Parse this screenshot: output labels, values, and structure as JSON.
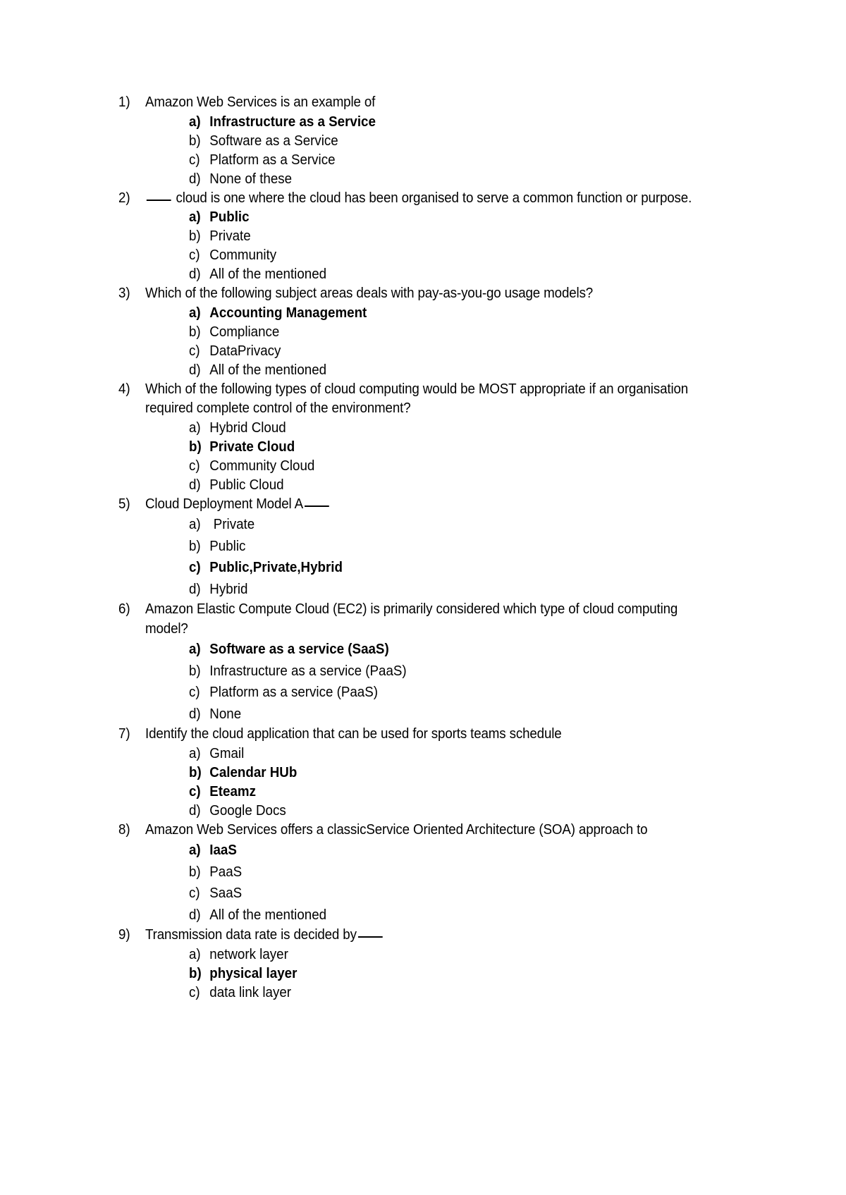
{
  "document": {
    "type": "multiple-choice-quiz",
    "questions": [
      {
        "number": "1)",
        "text": "Amazon Web Services is an example of",
        "has_blank": false,
        "options": [
          {
            "marker": "a)",
            "label": "Infrastructure as a Service",
            "correct": true
          },
          {
            "marker": "b)",
            "label": "Software as a Service",
            "correct": false
          },
          {
            "marker": "c)",
            "label": "Platform  as a Service",
            "correct": false
          },
          {
            "marker": "d)",
            "label": "None of these",
            "correct": false
          }
        ]
      },
      {
        "number": "2)",
        "text_before_blank": "",
        "text": " cloud is one where the cloud has been organised to serve a common function or purpose.",
        "has_blank": true,
        "options": [
          {
            "marker": "a)",
            "label": "Public",
            "correct": true
          },
          {
            "marker": "b)",
            "label": "Private",
            "correct": false
          },
          {
            "marker": "c)",
            "label": "Community",
            "correct": false
          },
          {
            "marker": "d)",
            "label": "All of the mentioned",
            "correct": false
          }
        ]
      },
      {
        "number": "3)",
        "text": "Which of the following subject areas deals with pay-as-you-go usage models?",
        "has_blank": false,
        "options": [
          {
            "marker": "a)",
            "label": "Accounting Management",
            "correct": true
          },
          {
            "marker": "b)",
            "label": "Compliance",
            "correct": false
          },
          {
            "marker": "c)",
            "label": "DataPrivacy",
            "correct": false
          },
          {
            "marker": "d)",
            "label": "All of the mentioned",
            "correct": false
          }
        ]
      },
      {
        "number": "4)",
        "text": "Which of the following types of cloud computing would be MOST appropriate if an organisation required complete control of the environment?",
        "has_blank": false,
        "options": [
          {
            "marker": "a)",
            "label": "Hybrid Cloud",
            "correct": false
          },
          {
            "marker": "b)",
            "label": "Private Cloud",
            "correct": true
          },
          {
            "marker": "c)",
            "label": "Community Cloud",
            "correct": false
          },
          {
            "marker": "d)",
            "label": "Public Cloud",
            "correct": false
          }
        ]
      },
      {
        "number": "5)",
        "text": "Cloud Deployment Model A",
        "has_blank": false,
        "trailing_blank": true,
        "loose": true,
        "options": [
          {
            "marker": "a)",
            "label": "Private",
            "correct": false,
            "extra_indent": true
          },
          {
            "marker": "b)",
            "label": "Public",
            "correct": false
          },
          {
            "marker": "c)",
            "label": "Public,Private,Hybrid",
            "correct": true
          },
          {
            "marker": "d)",
            "label": "Hybrid",
            "correct": false
          }
        ]
      },
      {
        "number": "6)",
        "text": "Amazon Elastic Compute Cloud (EC2) is primarily considered which type of cloud computing model?",
        "has_blank": false,
        "loose": true,
        "options": [
          {
            "marker": "a)",
            "label": "Software as a service (SaaS)",
            "correct": true
          },
          {
            "marker": "b)",
            "label": "Infrastructure as a service (PaaS)",
            "correct": false
          },
          {
            "marker": "c)",
            "label": "Platform as a service (PaaS)",
            "correct": false
          },
          {
            "marker": "d)",
            "label": "None",
            "correct": false
          }
        ]
      },
      {
        "number": "7)",
        "text": "Identify the cloud application that can be used for sports teams schedule",
        "has_blank": false,
        "options": [
          {
            "marker": "a)",
            "label": "Gmail",
            "correct": false
          },
          {
            "marker": "b)",
            "label": "Calendar HUb",
            "correct": true
          },
          {
            "marker": "c)",
            "label": "Eteamz",
            "correct": true
          },
          {
            "marker": "d)",
            "label": "Google Docs",
            "correct": false
          }
        ]
      },
      {
        "number": "8)",
        "text": "Amazon Web Services offers a classicService Oriented Architecture (SOA) approach to",
        "has_blank": false,
        "loose": true,
        "options": [
          {
            "marker": "a)",
            "label": "IaaS",
            "correct": true
          },
          {
            "marker": "b)",
            "label": "PaaS",
            "correct": false
          },
          {
            "marker": "c)",
            "label": "SaaS",
            "correct": false
          },
          {
            "marker": "d)",
            "label": "All of the mentioned",
            "correct": false
          }
        ]
      },
      {
        "number": "9)",
        "text": "Transmission data rate is decided by",
        "has_blank": false,
        "trailing_blank": true,
        "options": [
          {
            "marker": "a)",
            "label": "network layer",
            "correct": false
          },
          {
            "marker": "b)",
            "label": "physical layer",
            "correct": true
          },
          {
            "marker": "c)",
            "label": "data link layer",
            "correct": false
          }
        ]
      }
    ]
  }
}
